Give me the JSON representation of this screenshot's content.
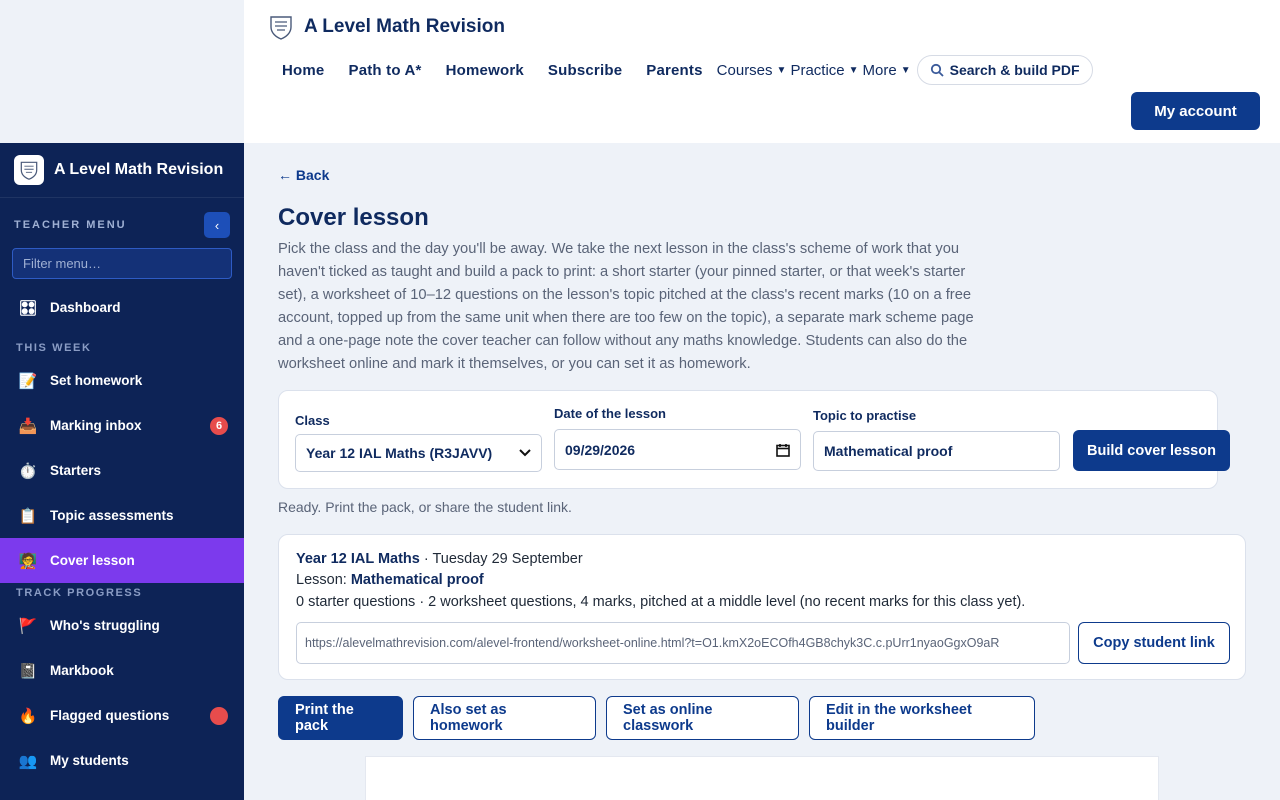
{
  "header": {
    "title": "A Level Math Revision",
    "nav": [
      "Home",
      "Path to A*",
      "Homework",
      "Subscribe",
      "Parents"
    ],
    "dropdowns": [
      "Courses",
      "Practice",
      "More"
    ],
    "search_label": "Search & build PDF",
    "account_label": "My account"
  },
  "sidebar": {
    "title": "A Level Math Revision",
    "menu_label": "TEACHER MENU",
    "collapse_glyph": "‹",
    "filter_placeholder": "Filter menu…",
    "dashboard": {
      "label": "Dashboard",
      "icon": "dashboard-icon"
    },
    "section_this_week": "THIS WEEK",
    "this_week": [
      {
        "label": "Set homework",
        "icon": "memo-icon"
      },
      {
        "label": "Marking inbox",
        "icon": "inbox-icon",
        "badge": "6"
      },
      {
        "label": "Starters",
        "icon": "stopwatch-icon"
      },
      {
        "label": "Topic assessments",
        "icon": "clipboard-icon"
      },
      {
        "label": "Cover lesson",
        "icon": "teacher-icon",
        "active": true
      }
    ],
    "section_track": "TRACK PROGRESS",
    "track": [
      {
        "label": "Who's struggling",
        "icon": "flag-icon"
      },
      {
        "label": "Markbook",
        "icon": "notebook-icon"
      },
      {
        "label": "Flagged questions",
        "icon": "fire-icon",
        "dot": true
      },
      {
        "label": "My students",
        "icon": "people-icon"
      }
    ]
  },
  "main": {
    "back_label": "← Back",
    "title": "Cover lesson",
    "intro": "Pick the class and the day you'll be away. We take the next lesson in the class's scheme of work that you haven't ticked as taught and build a pack to print: a short starter (your pinned starter, or that week's starter set), a worksheet of 10–12 questions on the lesson's topic pitched at the class's recent marks (10 on a free account, topped up from the same unit when there are too few on the topic), a separate mark scheme page and a one-page note the cover teacher can follow without any maths knowledge. Students can also do the worksheet online and mark it themselves, or you can set it as homework.",
    "form": {
      "class_label": "Class",
      "class_value": "Year 12 IAL Maths (R3JAVV)",
      "date_label": "Date of the lesson",
      "date_value": "09/29/2026",
      "topic_label": "Topic to practise",
      "topic_value": "Mathematical proof",
      "build_label": "Build cover lesson"
    },
    "status": "Ready. Print the pack, or share the student link.",
    "result": {
      "class_name": "Year 12 IAL Maths",
      "date_text": " · Tuesday 29 September",
      "lesson_prefix": "Lesson: ",
      "lesson_name": "Mathematical proof",
      "summary": "0 starter questions · 2 worksheet questions, 4 marks, pitched at a middle level (no recent marks for this class yet).",
      "link": "https://alevelmathrevision.com/alevel-frontend/worksheet-online.html?t=O1.kmX2oECOfh4GB8chyk3C.c.pUrr1nyaoGgxO9aR",
      "copy_label": "Copy student link"
    },
    "actions": {
      "print": "Print the pack",
      "homework": "Also set as homework",
      "classwork": "Set as online classwork",
      "edit": "Edit in the worksheet builder"
    }
  }
}
